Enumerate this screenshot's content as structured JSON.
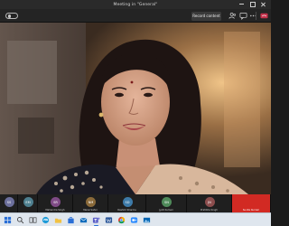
{
  "window": {
    "title": "Meeting in \"General\"",
    "controls": [
      "minimize-icon",
      "maximize-icon",
      "close-icon"
    ]
  },
  "toolbar": {
    "record_label": "Record content",
    "icons": [
      "participants-icon",
      "chat-icon",
      "raise-hand-icon",
      "more-icon",
      "camera-icon",
      "leave-call-icon"
    ]
  },
  "main_video": {
    "subject": "speaker-video"
  },
  "participants": [
    {
      "initials": "SS",
      "name": "",
      "color": "#6c6f9c"
    },
    {
      "initials": "EM",
      "name": "",
      "color": "#4e7f8f"
    },
    {
      "initials": "SR",
      "name": "Mahendra Singh",
      "color": "#7f4b86"
    },
    {
      "initials": "NM",
      "name": "Mansi Sahni",
      "color": "#8a6a3a"
    },
    {
      "initials": "SD",
      "name": "Rashmi Sharma",
      "color": "#3d7aa8"
    },
    {
      "initials": "SN",
      "name": "Jyoti Kumari",
      "color": "#4f8a5a"
    },
    {
      "initials": "JN",
      "name": "Pratibha Singh",
      "color": "#8c4d4d"
    },
    {
      "initials": "",
      "name": "Sunita Kumari",
      "color": "#d22a23"
    }
  ],
  "taskbar": {
    "apps": [
      "start-icon",
      "search-icon",
      "task-view-icon",
      "edge-icon",
      "explorer-icon",
      "store-icon",
      "mail-icon",
      "teams-icon",
      "word-icon",
      "chrome-icon",
      "zoom-icon",
      "photos-icon"
    ],
    "clock_time": "",
    "clock_date": "",
    "accent": "#2a6fd6"
  },
  "colors": {
    "toolbar_bg": "#242424",
    "active_speaker": "#d22a23"
  }
}
